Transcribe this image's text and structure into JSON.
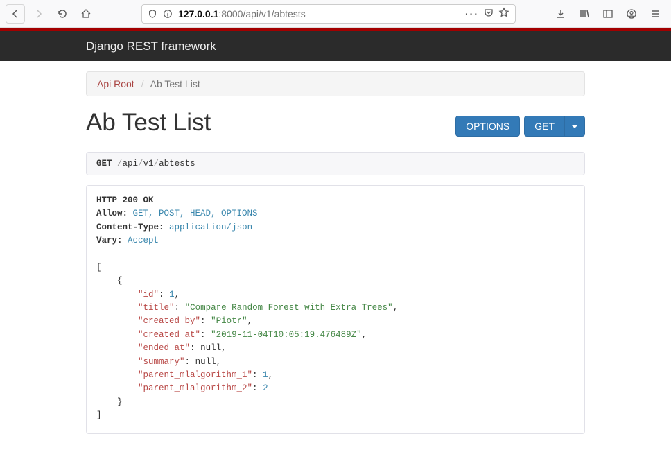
{
  "browser": {
    "url_host": "127.0.0.1",
    "url_rest": ":8000/api/v1/abtests"
  },
  "navbar": {
    "brand": "Django REST framework"
  },
  "breadcrumb": {
    "root_label": "Api Root",
    "sep": "/",
    "current": "Ab Test List"
  },
  "page_title": "Ab Test List",
  "buttons": {
    "options": "OPTIONS",
    "get": "GET"
  },
  "request": {
    "method": "GET",
    "path_segments": [
      "api",
      "v1",
      "abtests"
    ]
  },
  "response": {
    "status_line": "HTTP 200 OK",
    "headers": {
      "allow_label": "Allow:",
      "allow_value": "GET, POST, HEAD, OPTIONS",
      "content_type_label": "Content-Type:",
      "content_type_value": "application/json",
      "vary_label": "Vary:",
      "vary_value": "Accept"
    },
    "body": [
      {
        "id": 1,
        "title": "Compare Random Forest with Extra Trees",
        "created_by": "Piotr",
        "created_at": "2019-11-04T10:05:19.476489Z",
        "ended_at": null,
        "summary": null,
        "parent_mlalgorithm_1": 1,
        "parent_mlalgorithm_2": 2
      }
    ],
    "labels": {
      "k_id": "\"id\"",
      "k_title": "\"title\"",
      "k_created_by": "\"created_by\"",
      "k_created_at": "\"created_at\"",
      "k_ended_at": "\"ended_at\"",
      "k_summary": "\"summary\"",
      "k_pma1": "\"parent_mlalgorithm_1\"",
      "k_pma2": "\"parent_mlalgorithm_2\"",
      "v_id": "1",
      "v_title": "\"Compare Random Forest with Extra Trees\"",
      "v_created_by": "\"Piotr\"",
      "v_created_at": "\"2019-11-04T10:05:19.476489Z\"",
      "v_ended_at": "null",
      "v_summary": "null",
      "v_pma1": "1",
      "v_pma2": "2"
    }
  }
}
